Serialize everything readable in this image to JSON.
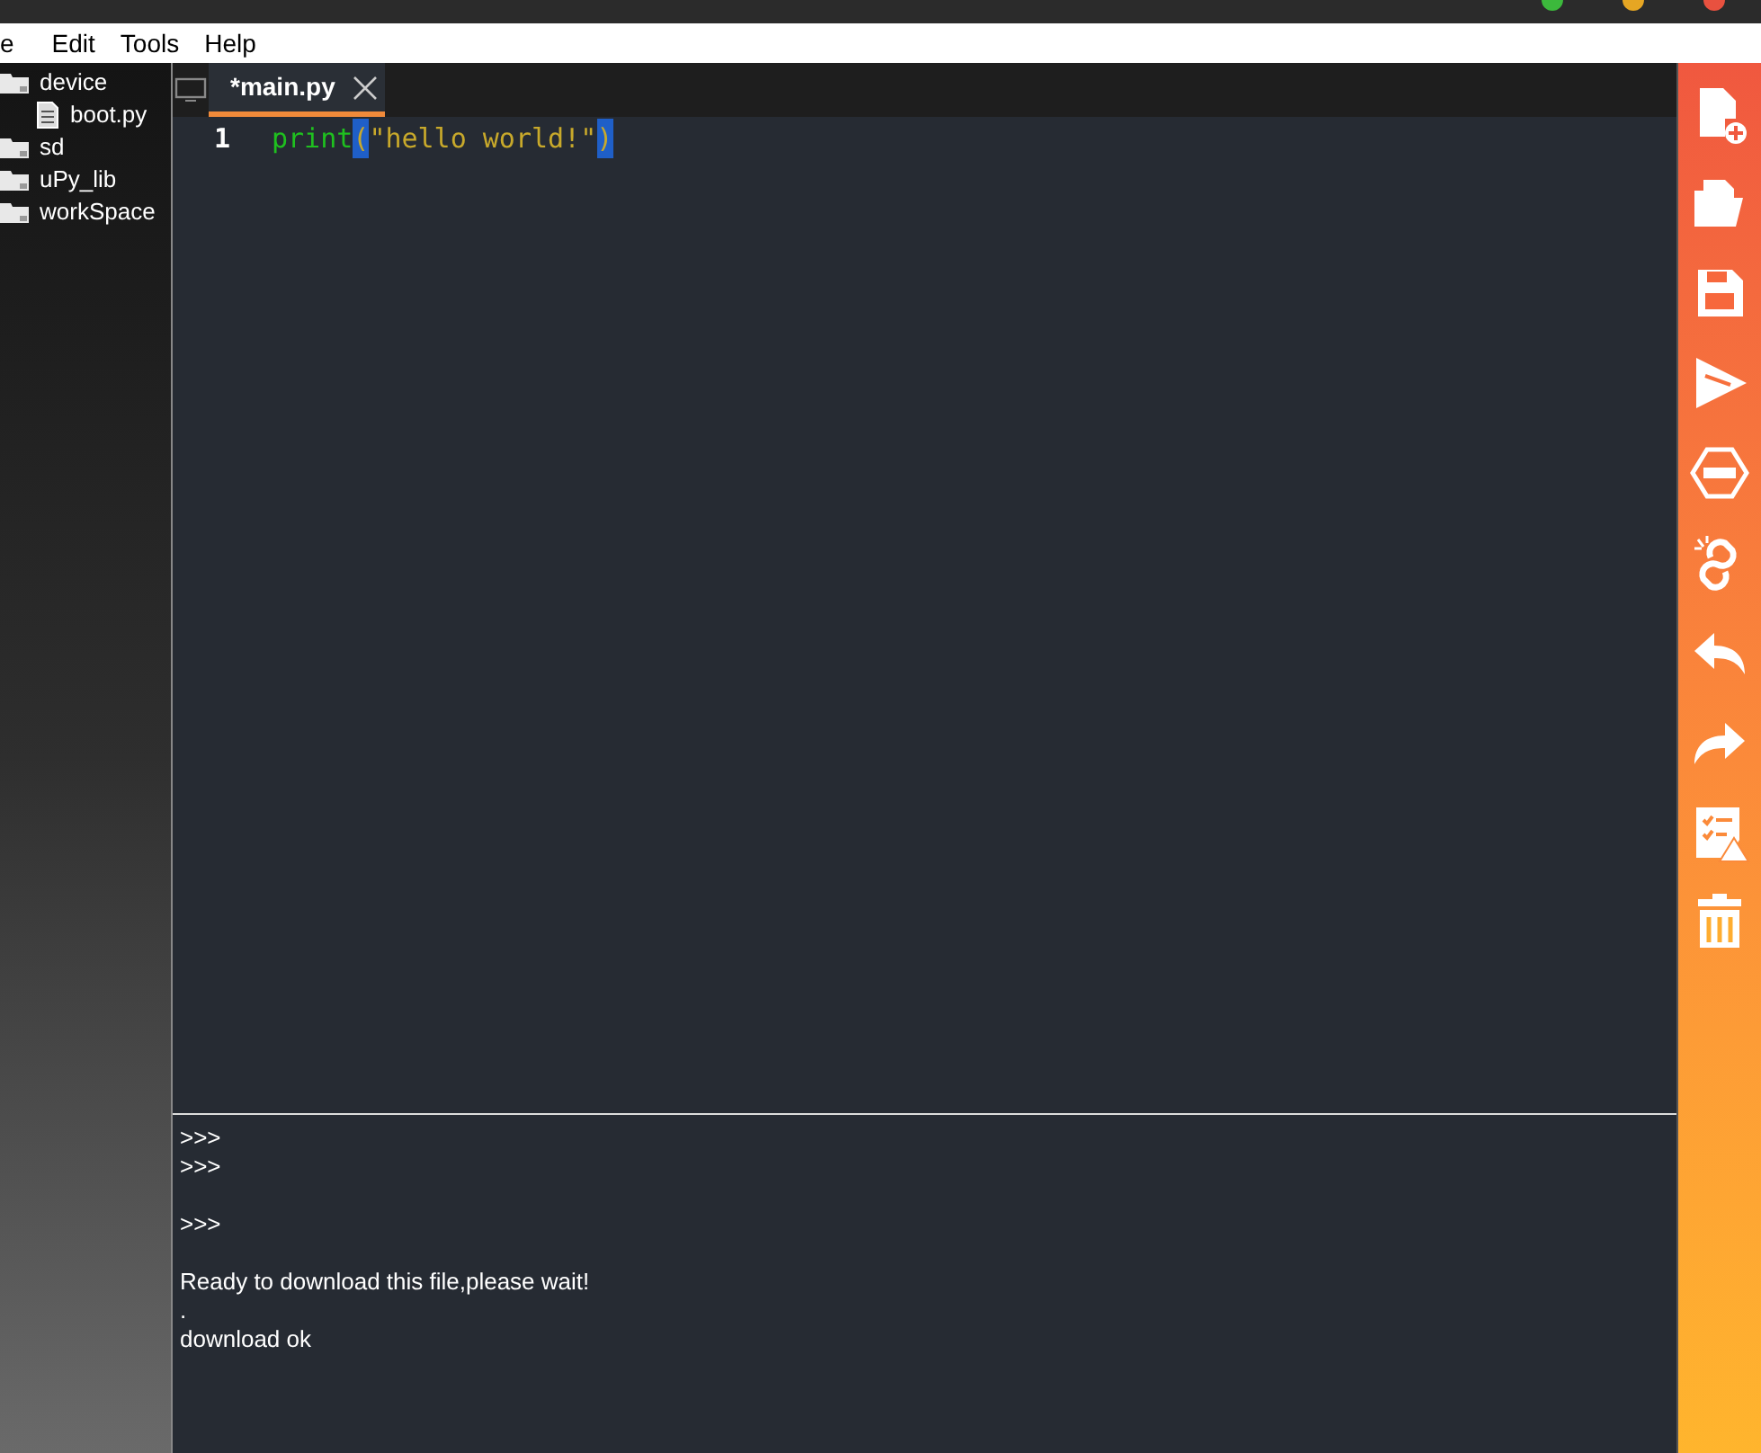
{
  "menu": [
    "e",
    "Edit",
    "Tools",
    "Help"
  ],
  "tree": [
    {
      "label": "device",
      "kind": "folder",
      "children": [
        {
          "label": "boot.py",
          "kind": "file"
        }
      ]
    },
    {
      "label": "sd",
      "kind": "folder"
    },
    {
      "label": "uPy_lib",
      "kind": "folder"
    },
    {
      "label": "workSpace",
      "kind": "folder"
    }
  ],
  "tabs": [
    {
      "label": "*main.py",
      "selected": true
    }
  ],
  "editor": {
    "lines": [
      {
        "number": "1",
        "tokens": [
          {
            "text": "print",
            "kind": "builtin",
            "selected": false
          },
          {
            "text": "(",
            "kind": "bracket",
            "selected": true
          },
          {
            "text": "\"hello world!\"",
            "kind": "string",
            "selected": false
          },
          {
            "text": ")",
            "kind": "bracket",
            "selected": true
          }
        ]
      }
    ]
  },
  "console": {
    "blocks": [
      {
        "lines": [
          ">>>",
          ">>>"
        ]
      },
      {
        "lines": [
          ">>>"
        ]
      },
      {
        "lines": [
          "Ready to download this file,please wait!",
          ".",
          "download ok"
        ]
      }
    ]
  }
}
